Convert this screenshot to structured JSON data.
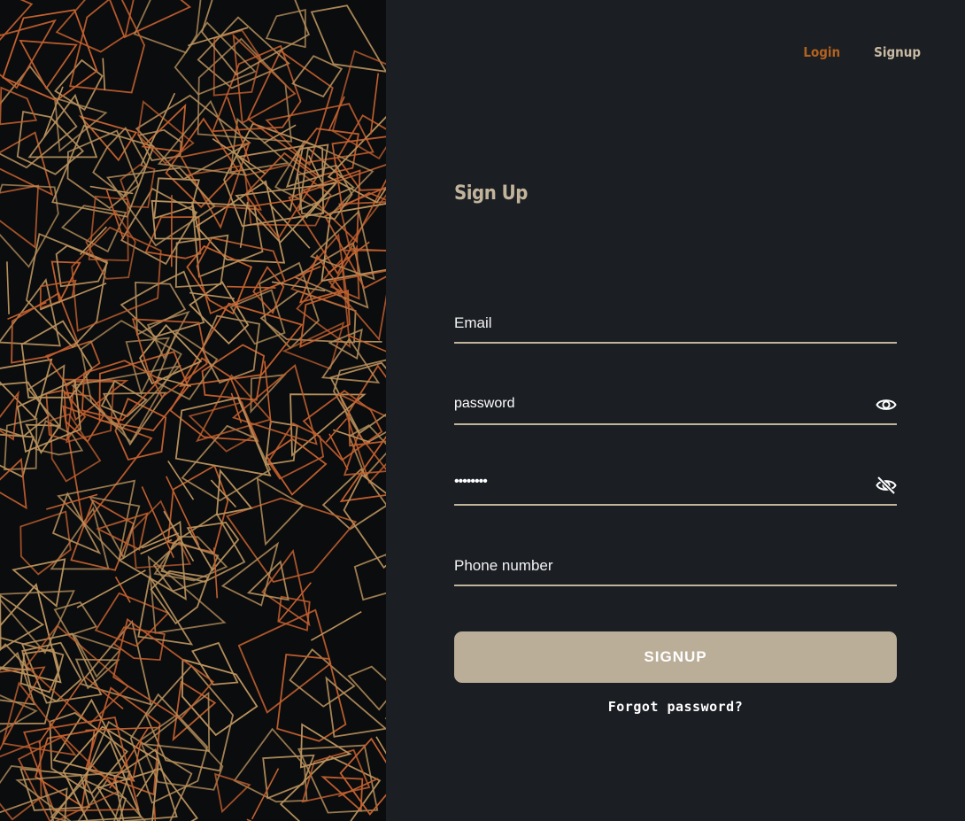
{
  "nav": {
    "login_label": "Login",
    "signup_label": "Signup"
  },
  "form": {
    "title": "Sign Up",
    "email_placeholder": "Email",
    "password_value": "password",
    "confirm_value": "••••••••",
    "phone_placeholder": "Phone number",
    "submit_label": "SIGNUP",
    "forgot_label": "Forgot password?"
  },
  "icons": {
    "password_toggle": "eye-icon",
    "confirm_toggle": "eye-off-icon"
  },
  "colors": {
    "background": "#1b1e23",
    "accent": "#b3621f",
    "beige": "#c2b49b",
    "button": "#bbae98",
    "art_dark": "#0b0c0e",
    "art_line_warm": "#c2602f",
    "art_line_light": "#b9925d"
  }
}
